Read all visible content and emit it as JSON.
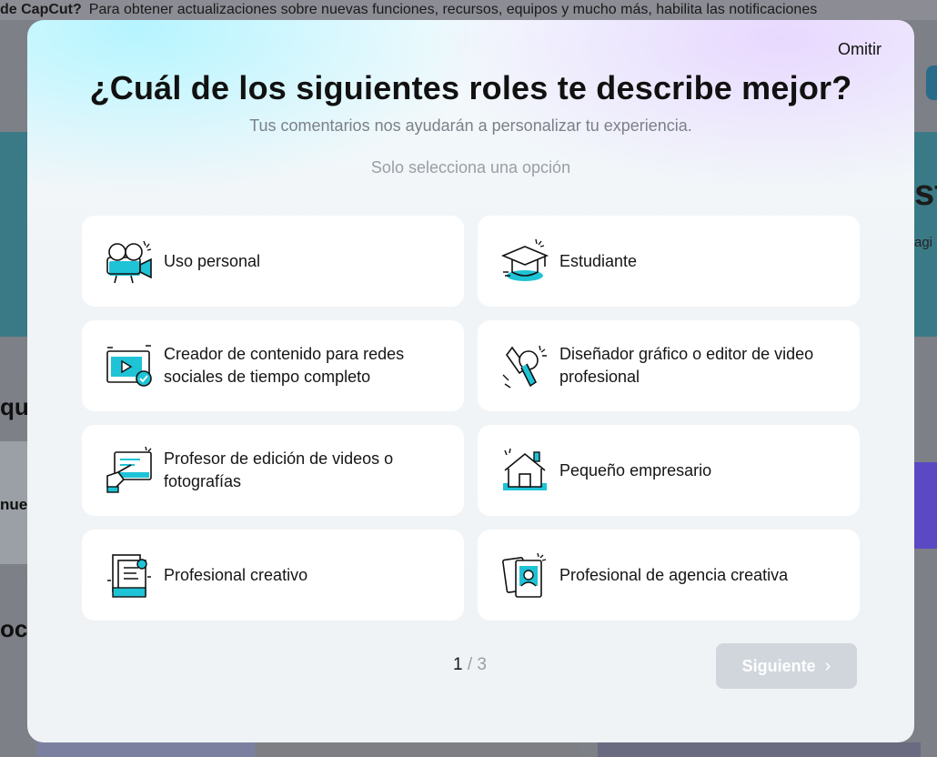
{
  "background": {
    "banner_strong": "de CapCut?",
    "banner_text": "Para obtener actualizaciones sobre nuevas funciones, recursos, equipos y mucho más, habilita las notificaciones",
    "hero_fragment": "st",
    "hero_fragment_2": "agi",
    "left_fragment_1": "qu",
    "left_fragment_2": "nue",
    "left_fragment_3": "oce"
  },
  "modal": {
    "skip_label": "Omitir",
    "title": "¿Cuál de los siguientes roles te describe mejor?",
    "subtitle": "Tus comentarios nos ayudarán a personalizar tu experiencia.",
    "hint": "Solo selecciona una opción",
    "options": [
      {
        "label": "Uso personal",
        "icon": "personal-camera-icon"
      },
      {
        "label": "Estudiante",
        "icon": "graduation-cap-icon"
      },
      {
        "label": "Creador de contenido para redes sociales de tiempo completo",
        "icon": "video-creator-icon"
      },
      {
        "label": "Diseñador gráfico o editor de video profesional",
        "icon": "design-tools-icon"
      },
      {
        "label": "Profesor de edición de videos o fotografías",
        "icon": "teacher-board-icon"
      },
      {
        "label": "Pequeño empresario",
        "icon": "small-business-house-icon"
      },
      {
        "label": "Profesional creativo",
        "icon": "creative-document-icon"
      },
      {
        "label": "Profesional de agencia creativa",
        "icon": "agency-portfolio-icon"
      }
    ],
    "pager": {
      "current": "1",
      "separator": "/",
      "total": "3"
    },
    "next_label": "Siguiente",
    "accent_color": "#1fc3d6"
  }
}
